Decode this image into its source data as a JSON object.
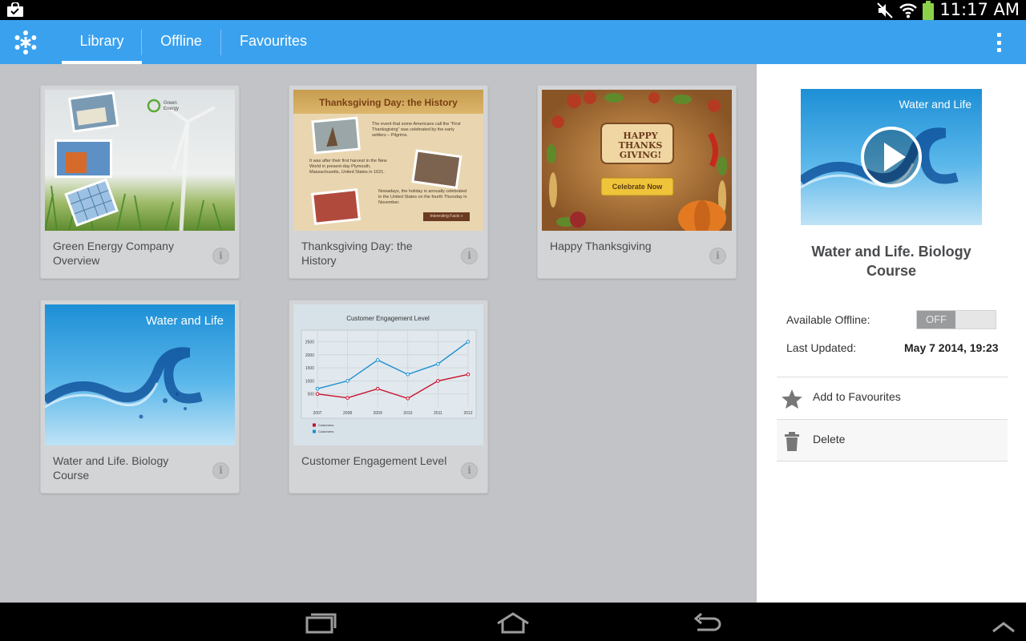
{
  "status_bar": {
    "time": "11:17 AM",
    "icons": [
      "shopping-bag-icon",
      "mute-icon",
      "wifi-icon",
      "battery-icon"
    ]
  },
  "app_bar": {
    "logo": "pinwheel-logo-icon",
    "tabs": [
      {
        "label": "Library",
        "active": true
      },
      {
        "label": "Offline",
        "active": false
      },
      {
        "label": "Favourites",
        "active": false
      }
    ],
    "overflow_icon": "overflow-menu-icon",
    "color": "#3aa1ee"
  },
  "library": {
    "items": [
      {
        "title": "Green Energy Company Overview",
        "thumb_text": "Green Energy",
        "info": "i"
      },
      {
        "title": "Thanksgiving Day: the History",
        "thumb_text": "Thanksgiving Day: the History",
        "info": "i",
        "thumb_body": [
          "The event that some Americans call the \"First Thanksgiving\" was celebrated by the early settlers – Pilgrims.",
          "It was after their first harvest in the New World in present-day Plymouth, Massachusetts, United States in 1621.",
          "Nowadays, the holiday is annually celebrated in the United States on the fourth Thursday in November."
        ],
        "thumb_button": "Interesting Facts »"
      },
      {
        "title": "Happy Thanksgiving",
        "thumb_text": "HAPPY THANKS GIVING!",
        "thumb_button": "Celebrate Now",
        "info": "i"
      },
      {
        "title": "Water and Life. Biology Course",
        "thumb_text": "Water and Life",
        "info": "i"
      },
      {
        "title": "Customer Engagement Level",
        "thumb_text": "Customer Engagement Level",
        "info": "i"
      }
    ]
  },
  "chart_data": {
    "type": "line",
    "title": "Customer Engagement Level",
    "x": [
      "2007",
      "2008",
      "2009",
      "2010",
      "2011",
      "2012"
    ],
    "yticks": [
      500,
      1000,
      1500,
      2000,
      2500
    ],
    "ylim": [
      0,
      2700
    ],
    "series": [
      {
        "name": "Customers",
        "color": "#c8102e",
        "values": [
          500,
          350,
          700,
          330,
          1000,
          1250
        ]
      },
      {
        "name": "Customers",
        "color": "#1a8fd0",
        "values": [
          700,
          1000,
          1800,
          1250,
          1650,
          2500
        ]
      }
    ],
    "grid": true,
    "legend": "bottom-left"
  },
  "details": {
    "preview_text": "Water and Life",
    "title": "Water and Life. Biology Course",
    "available_offline_label": "Available Offline:",
    "toggle_state": "OFF",
    "last_updated_label": "Last Updated:",
    "last_updated_value": "May 7 2014, 19:23",
    "actions": [
      {
        "label": "Add to Favourites",
        "icon": "star-icon"
      },
      {
        "label": "Delete",
        "icon": "trash-icon"
      }
    ]
  },
  "nav_bar": {
    "icons": [
      "recent-apps-icon",
      "home-icon",
      "back-icon",
      "expand-up-icon"
    ]
  }
}
